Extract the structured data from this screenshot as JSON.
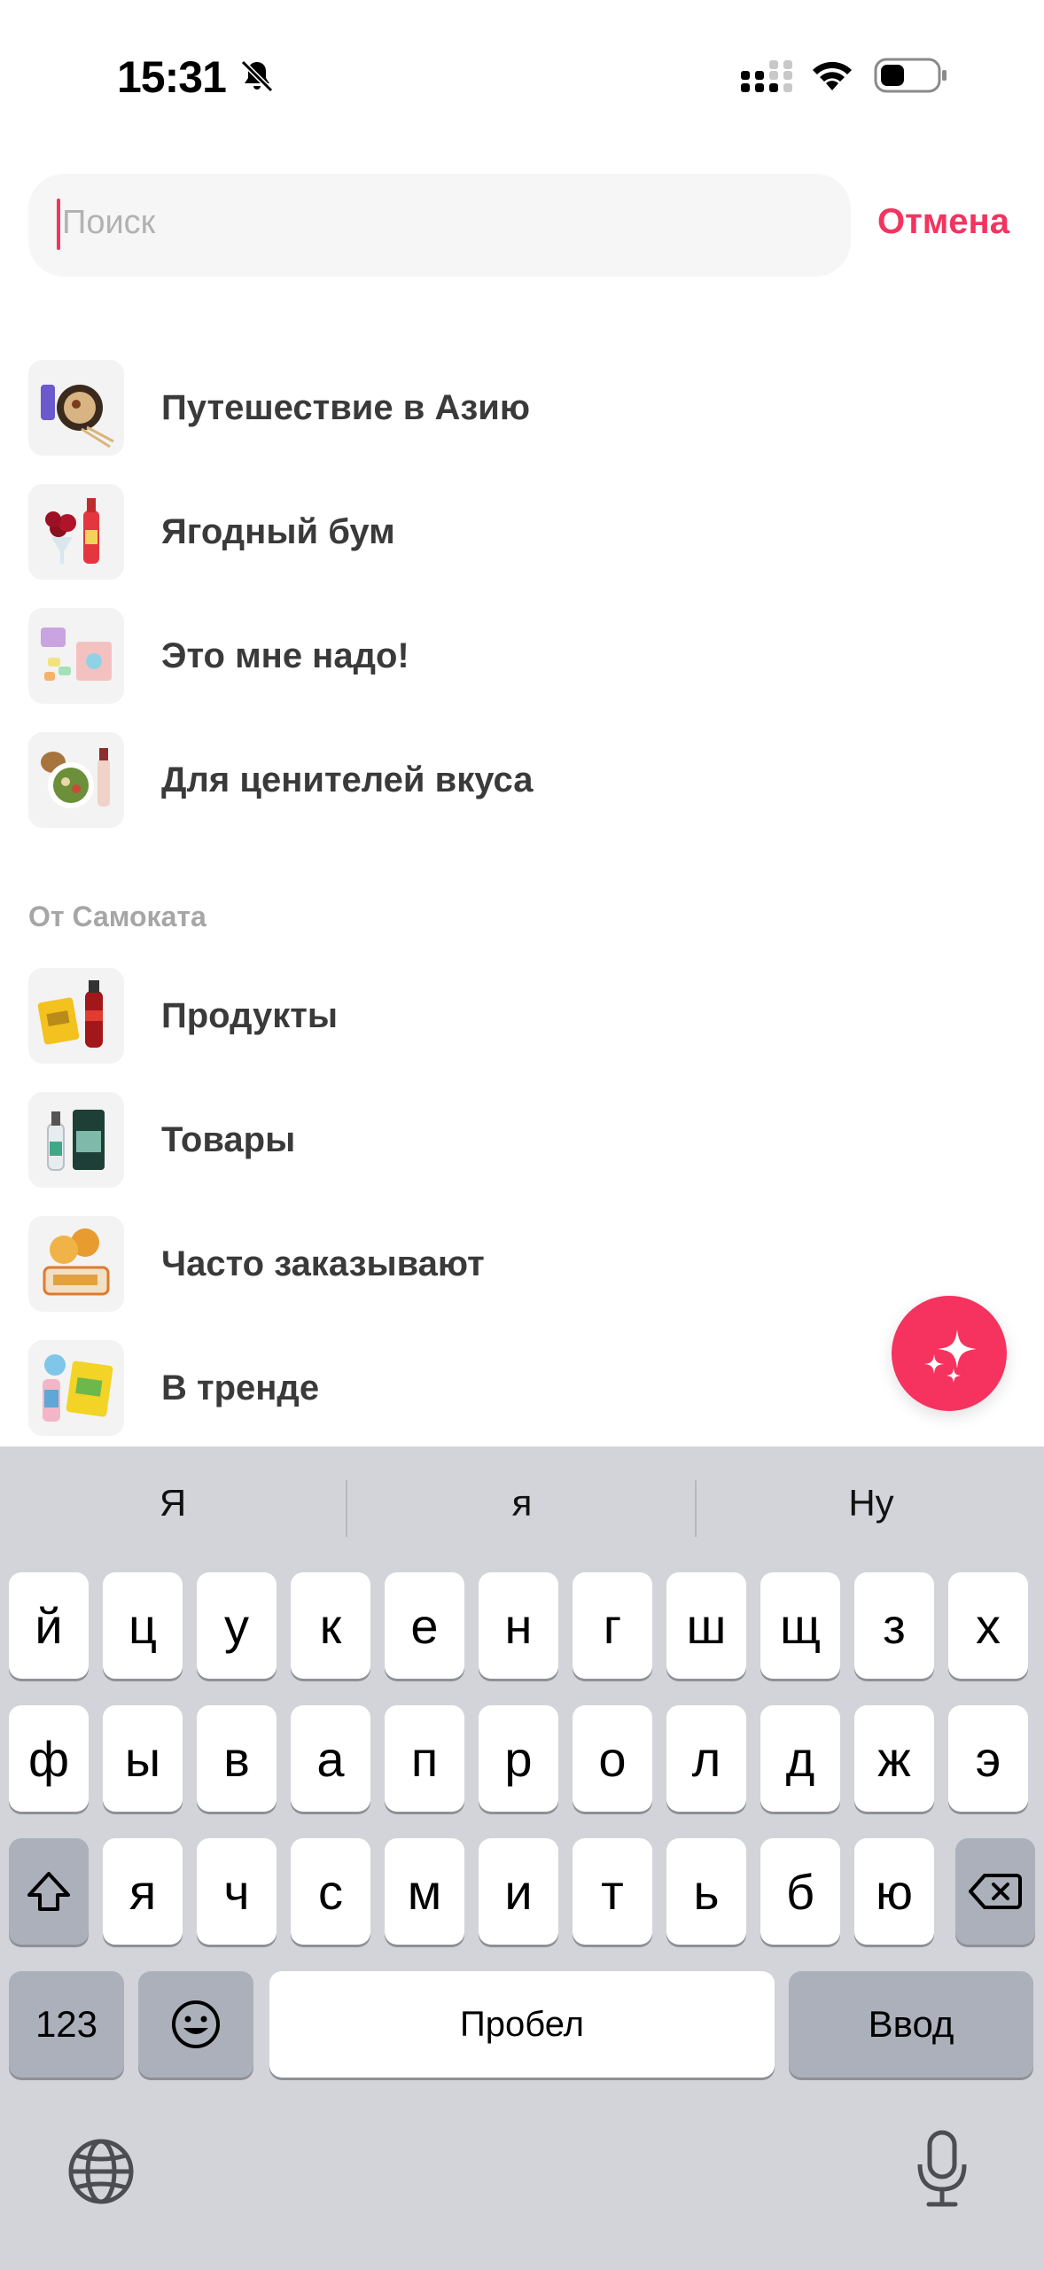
{
  "status_bar": {
    "time": "15:31"
  },
  "search": {
    "placeholder": "Поиск",
    "cancel_label": "Отмена"
  },
  "collections": [
    {
      "label": "Путешествие в Азию",
      "icon": "asia-food-thumbnail"
    },
    {
      "label": "Ягодный бум",
      "icon": "berries-thumbnail"
    },
    {
      "label": "Это мне надо!",
      "icon": "stationery-thumbnail"
    },
    {
      "label": "Для ценителей вкуса",
      "icon": "gourmet-thumbnail"
    }
  ],
  "samokat_section": {
    "header": "От Самоката",
    "items": [
      {
        "label": "Продукты",
        "icon": "groceries-thumbnail"
      },
      {
        "label": "Товары",
        "icon": "goods-thumbnail"
      },
      {
        "label": "Часто заказывают",
        "icon": "popular-thumbnail"
      },
      {
        "label": "В тренде",
        "icon": "trending-thumbnail"
      }
    ]
  },
  "fab": {
    "icon": "sparkles-icon",
    "color": "#f6325f"
  },
  "keyboard": {
    "suggestions": [
      "Я",
      "я",
      "Ну"
    ],
    "row1": [
      "й",
      "ц",
      "у",
      "к",
      "е",
      "н",
      "г",
      "ш",
      "щ",
      "з",
      "х"
    ],
    "row2": [
      "ф",
      "ы",
      "в",
      "а",
      "п",
      "р",
      "о",
      "л",
      "д",
      "ж",
      "э"
    ],
    "row3": [
      "я",
      "ч",
      "с",
      "м",
      "и",
      "т",
      "ь",
      "б",
      "ю"
    ],
    "numbers_label": "123",
    "space_label": "Пробел",
    "return_label": "Ввод"
  },
  "colors": {
    "accent": "#f2345f",
    "keyboard_bg": "#d2d4da",
    "search_bg": "#f6f6f6"
  }
}
